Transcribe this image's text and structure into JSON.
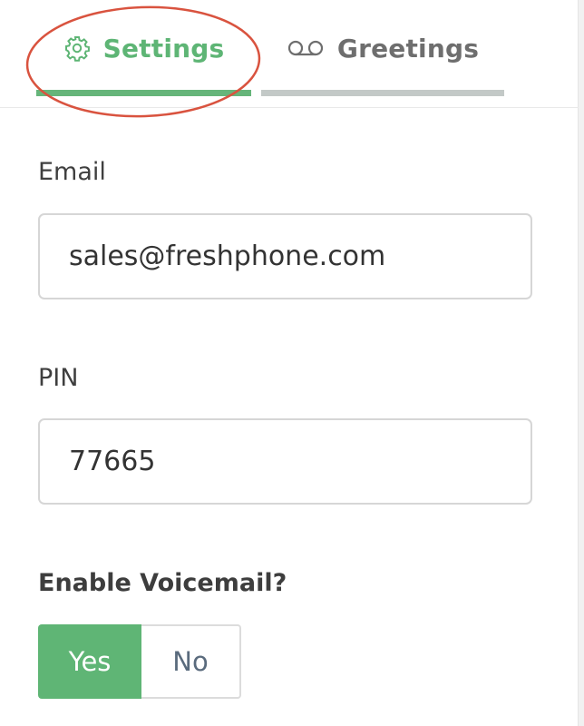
{
  "tabs": {
    "settings": {
      "label": "Settings",
      "icon": "gear-icon",
      "active": true
    },
    "greetings": {
      "label": "Greetings",
      "icon": "voicemail-icon",
      "active": false
    }
  },
  "form": {
    "email": {
      "label": "Email",
      "value": "sales@freshphone.com"
    },
    "pin": {
      "label": "PIN",
      "value": "77665"
    },
    "voicemail": {
      "label": "Enable Voicemail?",
      "options": [
        "Yes",
        "No"
      ],
      "selected": "Yes"
    }
  },
  "colors": {
    "accent_green": "#5eb575",
    "inactive_tab": "#6e6e6e",
    "annotation_red": "#d9533f"
  }
}
